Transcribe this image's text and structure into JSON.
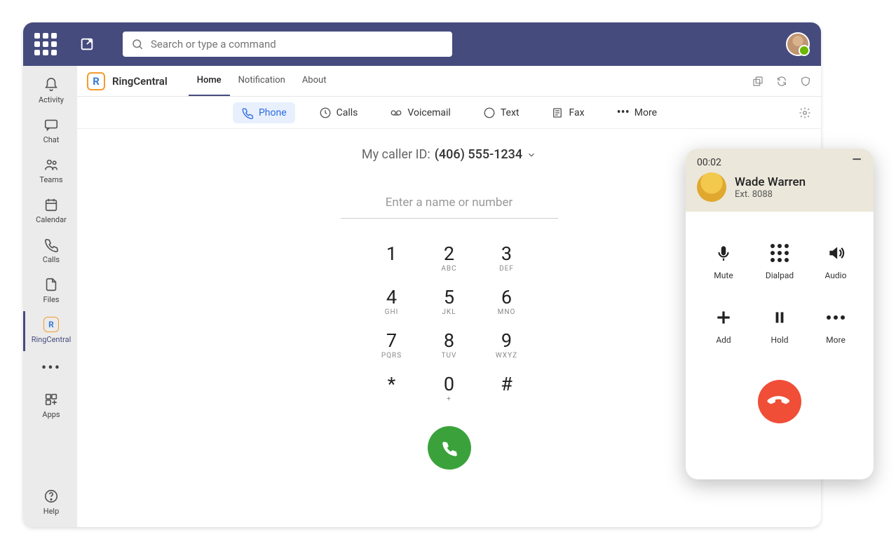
{
  "topbar": {
    "search_placeholder": "Search or type a command"
  },
  "leftnav": {
    "items": [
      {
        "label": "Activity"
      },
      {
        "label": "Chat"
      },
      {
        "label": "Teams"
      },
      {
        "label": "Calendar"
      },
      {
        "label": "Calls"
      },
      {
        "label": "Files"
      },
      {
        "label": "RingCentral"
      },
      {
        "label": "Apps"
      },
      {
        "label": "Help"
      }
    ]
  },
  "app": {
    "name": "RingCentral",
    "tabs": [
      {
        "label": "Home"
      },
      {
        "label": "Notification"
      },
      {
        "label": "About"
      }
    ]
  },
  "modes": {
    "phone": "Phone",
    "calls": "Calls",
    "voicemail": "Voicemail",
    "text": "Text",
    "fax": "Fax",
    "more": "More"
  },
  "dialer": {
    "caller_id_label": "My caller ID:",
    "caller_id_number": "(406) 555-1234",
    "input_placeholder": "Enter a name or number",
    "keys": [
      {
        "d": "1",
        "s": ""
      },
      {
        "d": "2",
        "s": "ABC"
      },
      {
        "d": "3",
        "s": "DEF"
      },
      {
        "d": "4",
        "s": "GHI"
      },
      {
        "d": "5",
        "s": "JKL"
      },
      {
        "d": "6",
        "s": "MNO"
      },
      {
        "d": "7",
        "s": "PQRS"
      },
      {
        "d": "8",
        "s": "TUV"
      },
      {
        "d": "9",
        "s": "WXYZ"
      },
      {
        "d": "*",
        "s": ""
      },
      {
        "d": "0",
        "s": "+"
      },
      {
        "d": "#",
        "s": ""
      }
    ]
  },
  "call_popup": {
    "timer": "00:02",
    "name": "Wade Warren",
    "ext": "Ext. 8088",
    "controls": {
      "mute": "Mute",
      "dialpad": "Dialpad",
      "audio": "Audio",
      "add": "Add",
      "hold": "Hold",
      "more": "More"
    }
  }
}
